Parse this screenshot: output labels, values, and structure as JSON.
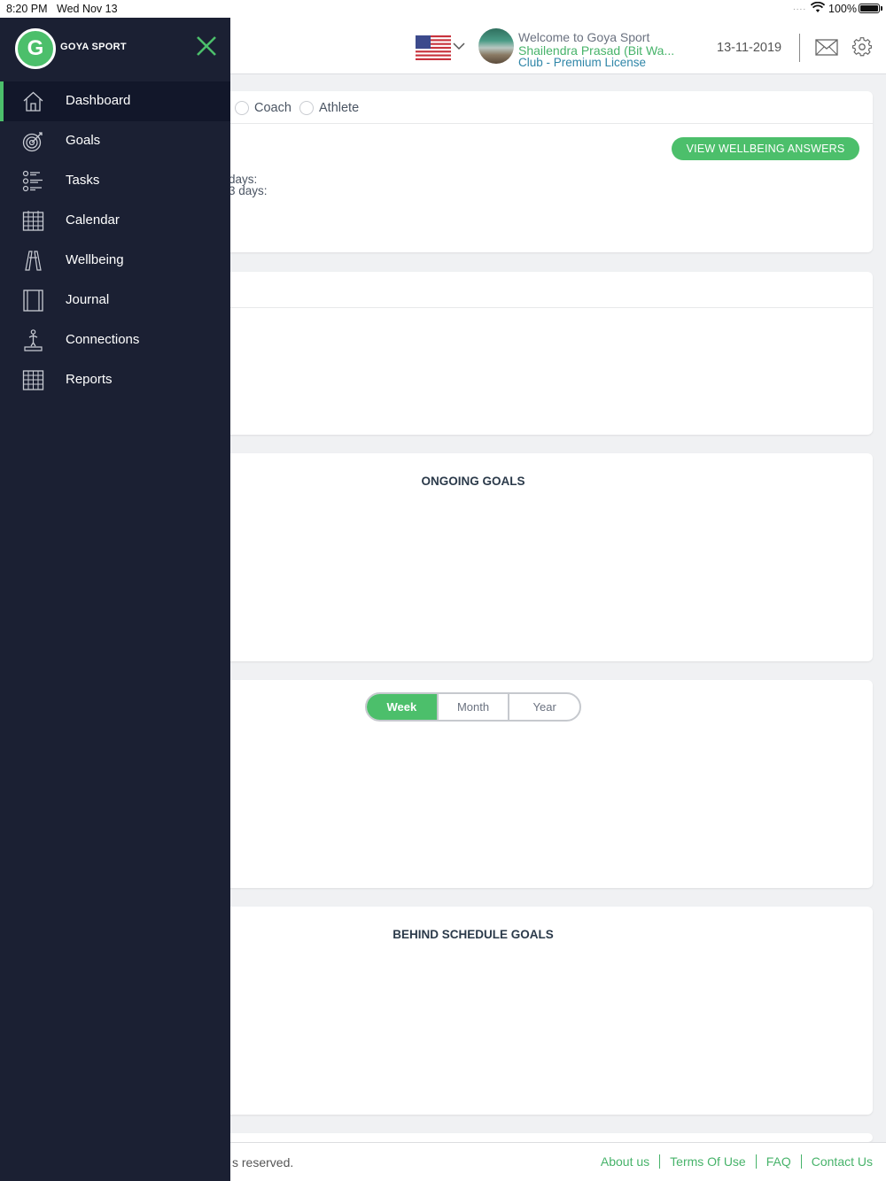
{
  "status_bar": {
    "time": "8:20 PM",
    "date": "Wed Nov 13",
    "signal": "....",
    "battery": "100%"
  },
  "header": {
    "welcome": "Welcome to Goya Sport",
    "user_name": "Shailendra Prasad (Bit Wa...",
    "license": "Club - Premium License",
    "date": "13-11-2019"
  },
  "sidebar": {
    "logo_letter": "G",
    "logo_text": "GOYA SPORT",
    "items": [
      {
        "label": "Dashboard",
        "icon": "home-icon",
        "active": true
      },
      {
        "label": "Goals",
        "icon": "target-icon"
      },
      {
        "label": "Tasks",
        "icon": "task-list-icon"
      },
      {
        "label": "Calendar",
        "icon": "calendar-icon"
      },
      {
        "label": "Wellbeing",
        "icon": "dumbbell-icon"
      },
      {
        "label": "Journal",
        "icon": "journal-icon"
      },
      {
        "label": "Connections",
        "icon": "person-podium-icon"
      },
      {
        "label": "Reports",
        "icon": "grid-report-icon"
      }
    ]
  },
  "roles": {
    "coach": "Coach",
    "athlete": "Athlete"
  },
  "wellbeing": {
    "button_label": "VIEW WELLBEING ANSWERS",
    "line1": "days:",
    "line2": "3 days:"
  },
  "ongoing_goals": {
    "title": "ONGOING GOALS"
  },
  "period_selector": {
    "options": [
      "Week",
      "Month",
      "Year"
    ],
    "selected": "Week"
  },
  "behind_schedule_goals": {
    "title": "BEHIND SCHEDULE GOALS"
  },
  "footer": {
    "copyright": "s reserved.",
    "links": [
      "About us",
      "Terms Of Use",
      "FAQ",
      "Contact Us"
    ]
  },
  "colors": {
    "accent_green": "#4cbf6b",
    "sidebar_bg": "#1b2033",
    "link_green": "#47b36a",
    "license_blue": "#2f86a8"
  }
}
